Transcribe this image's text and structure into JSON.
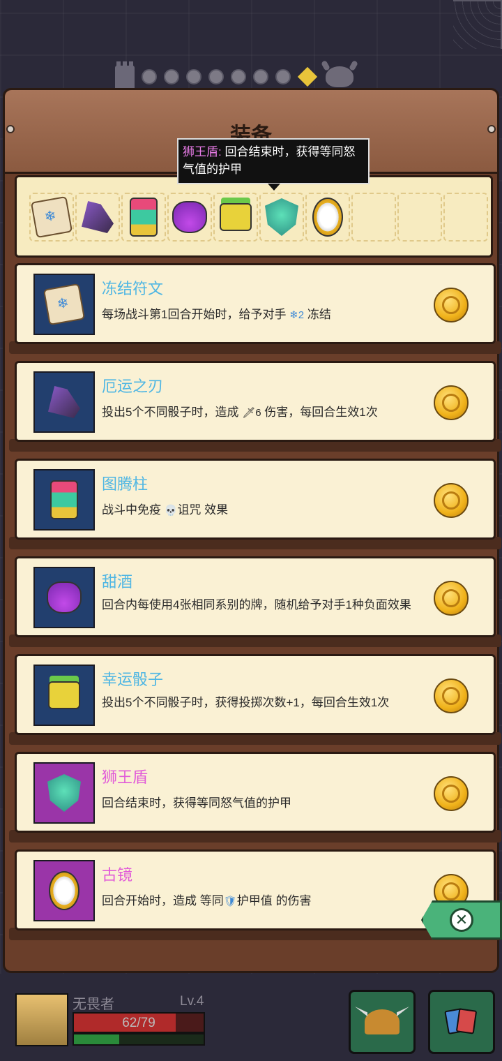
{
  "panel": {
    "title": "装备"
  },
  "tooltip": {
    "name": "狮王盾:",
    "text": " 回合结束时，获得等同怒气值的护甲"
  },
  "equipped_slots": [
    {
      "icon": "frost-rune-icon"
    },
    {
      "icon": "doom-blade-icon"
    },
    {
      "icon": "totem-icon"
    },
    {
      "icon": "sweet-wine-icon"
    },
    {
      "icon": "lucky-dice-icon"
    },
    {
      "icon": "lion-shield-icon"
    },
    {
      "icon": "ancient-mirror-icon"
    },
    {
      "icon": "empty-slot"
    },
    {
      "icon": "empty-slot"
    },
    {
      "icon": "empty-slot"
    }
  ],
  "items": [
    {
      "name": "冻结符文",
      "desc_a": "每场战斗第1回合开始时，给予对手 ",
      "tag": "❄2",
      "desc_b": " 冻结",
      "rarity_color": "#4fb6e3"
    },
    {
      "name": "厄运之刃",
      "desc_a": "投出5个不同骰子时，造成 ",
      "tag": "🗡6",
      "desc_b": " 伤害，每回合生效1次",
      "rarity_color": "#4fb6e3"
    },
    {
      "name": "图腾柱",
      "desc_a": "战斗中免疫 ",
      "tag": "💀",
      "desc_b": "诅咒 效果",
      "rarity_color": "#4fb6e3"
    },
    {
      "name": "甜酒",
      "desc_a": "回合内每使用4张相同系别的牌，随机给予对手1种负面效果",
      "tag": "",
      "desc_b": "",
      "rarity_color": "#4fb6e3"
    },
    {
      "name": "幸运骰子",
      "desc_a": "投出5个不同骰子时，获得投掷次数+1，每回合生效1次",
      "tag": "",
      "desc_b": "",
      "rarity_color": "#4fb6e3"
    },
    {
      "name": "狮王盾",
      "desc_a": "回合结束时，获得等同怒气值的护甲",
      "tag": "",
      "desc_b": "",
      "rarity_color": "#e15bd8"
    },
    {
      "name": "古镜",
      "desc_a": "回合开始时，造成 等同",
      "tag": "🛡",
      "desc_b": "护甲值 的伤害",
      "rarity_color": "#e15bd8"
    }
  ],
  "hero": {
    "name": "无畏者",
    "level": "Lv.4",
    "hp": "62/79",
    "hp_fraction": 0.785,
    "xp_fraction": 0.35
  },
  "colors": {
    "accent_blue": "#4fb6e3",
    "accent_pink": "#e15bd8",
    "wood": "#6a3e2a",
    "card_bg": "#faf1d4"
  }
}
